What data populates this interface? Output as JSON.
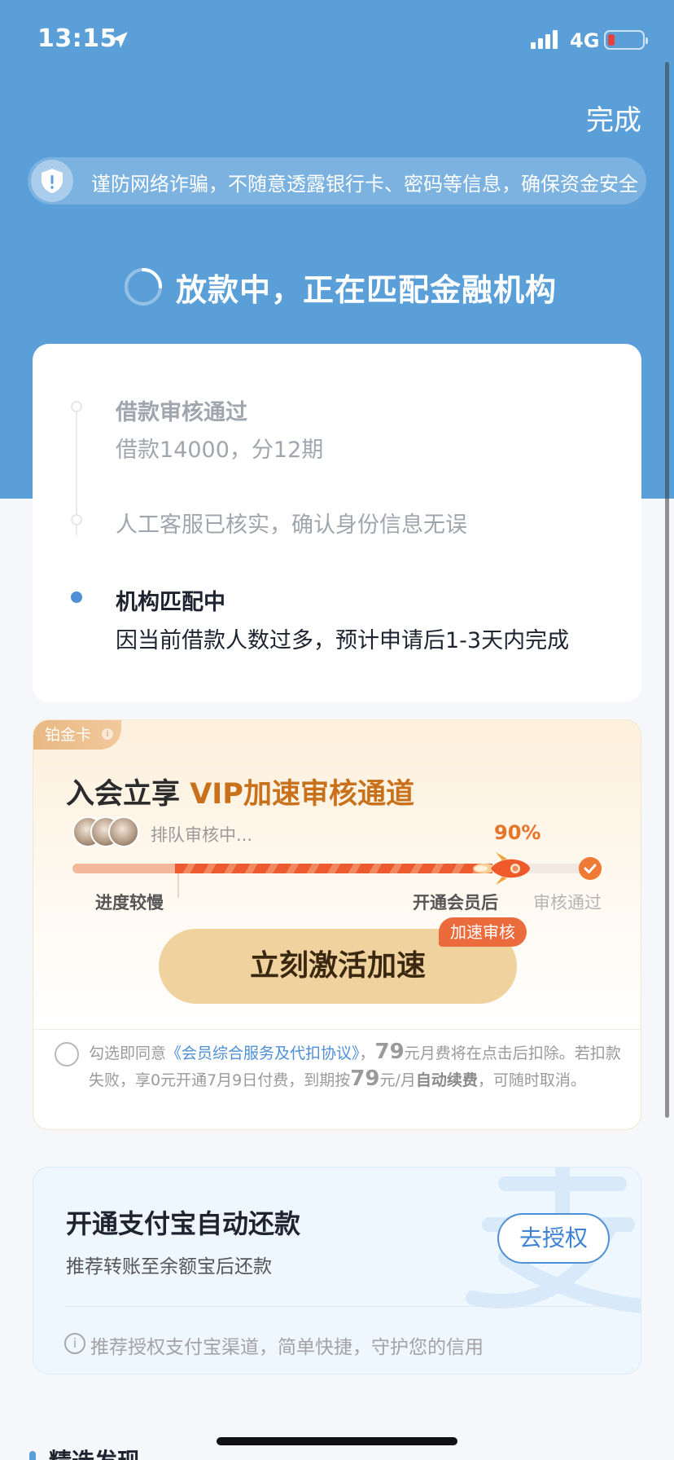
{
  "status_bar": {
    "time": "13:15",
    "network": "4G"
  },
  "nav": {
    "done_label": "完成"
  },
  "notice": {
    "text": "谨防网络诈骗，不随意透露银行卡、密码等信息，确保资金安全"
  },
  "loading": {
    "title": "放款中，正在匹配金融机构"
  },
  "steps": [
    {
      "title": "借款审核通过",
      "sub": "借款14000，分12期"
    },
    {
      "title": "人工客服已核实，确认身份信息无误"
    },
    {
      "title": "机构匹配中",
      "sub": "因当前借款人数过多，预计申请后1-3天内完成"
    }
  ],
  "vip": {
    "tag": "铂金卡",
    "title_prefix": "入会立享 ",
    "title_highlight": "VIP加速审核通道",
    "queue_text": "排队审核中...",
    "percent": "90%",
    "label_slow": "进度较慢",
    "label_after": "开通会员后",
    "label_pass": "审核通过",
    "cta_label": "立刻激活加速",
    "cta_badge": "加速审核",
    "agreement": {
      "prefix": "勾选即同意",
      "link": "《会员综合服务及代扣协议》",
      "comma": "，",
      "price1": "79",
      "mid1": "元月费将在点击后扣除。若扣款失败，享0元开通7月9日付费，到期按",
      "price2": "79",
      "mid2": "元/月",
      "auto": "自动续费",
      "suffix": "，可随时取消。"
    }
  },
  "alipay": {
    "title": "开通支付宝自动还款",
    "subtitle": "推荐转账至余额宝后还款",
    "button_label": "去授权",
    "note": "推荐授权支付宝渠道，简单快捷，守护您的信用"
  },
  "next_section": {
    "title": "精选发现"
  },
  "colors": {
    "primary": "#5b9fd9",
    "vip_accent": "#c8701a",
    "cta": "#f0d29e"
  }
}
